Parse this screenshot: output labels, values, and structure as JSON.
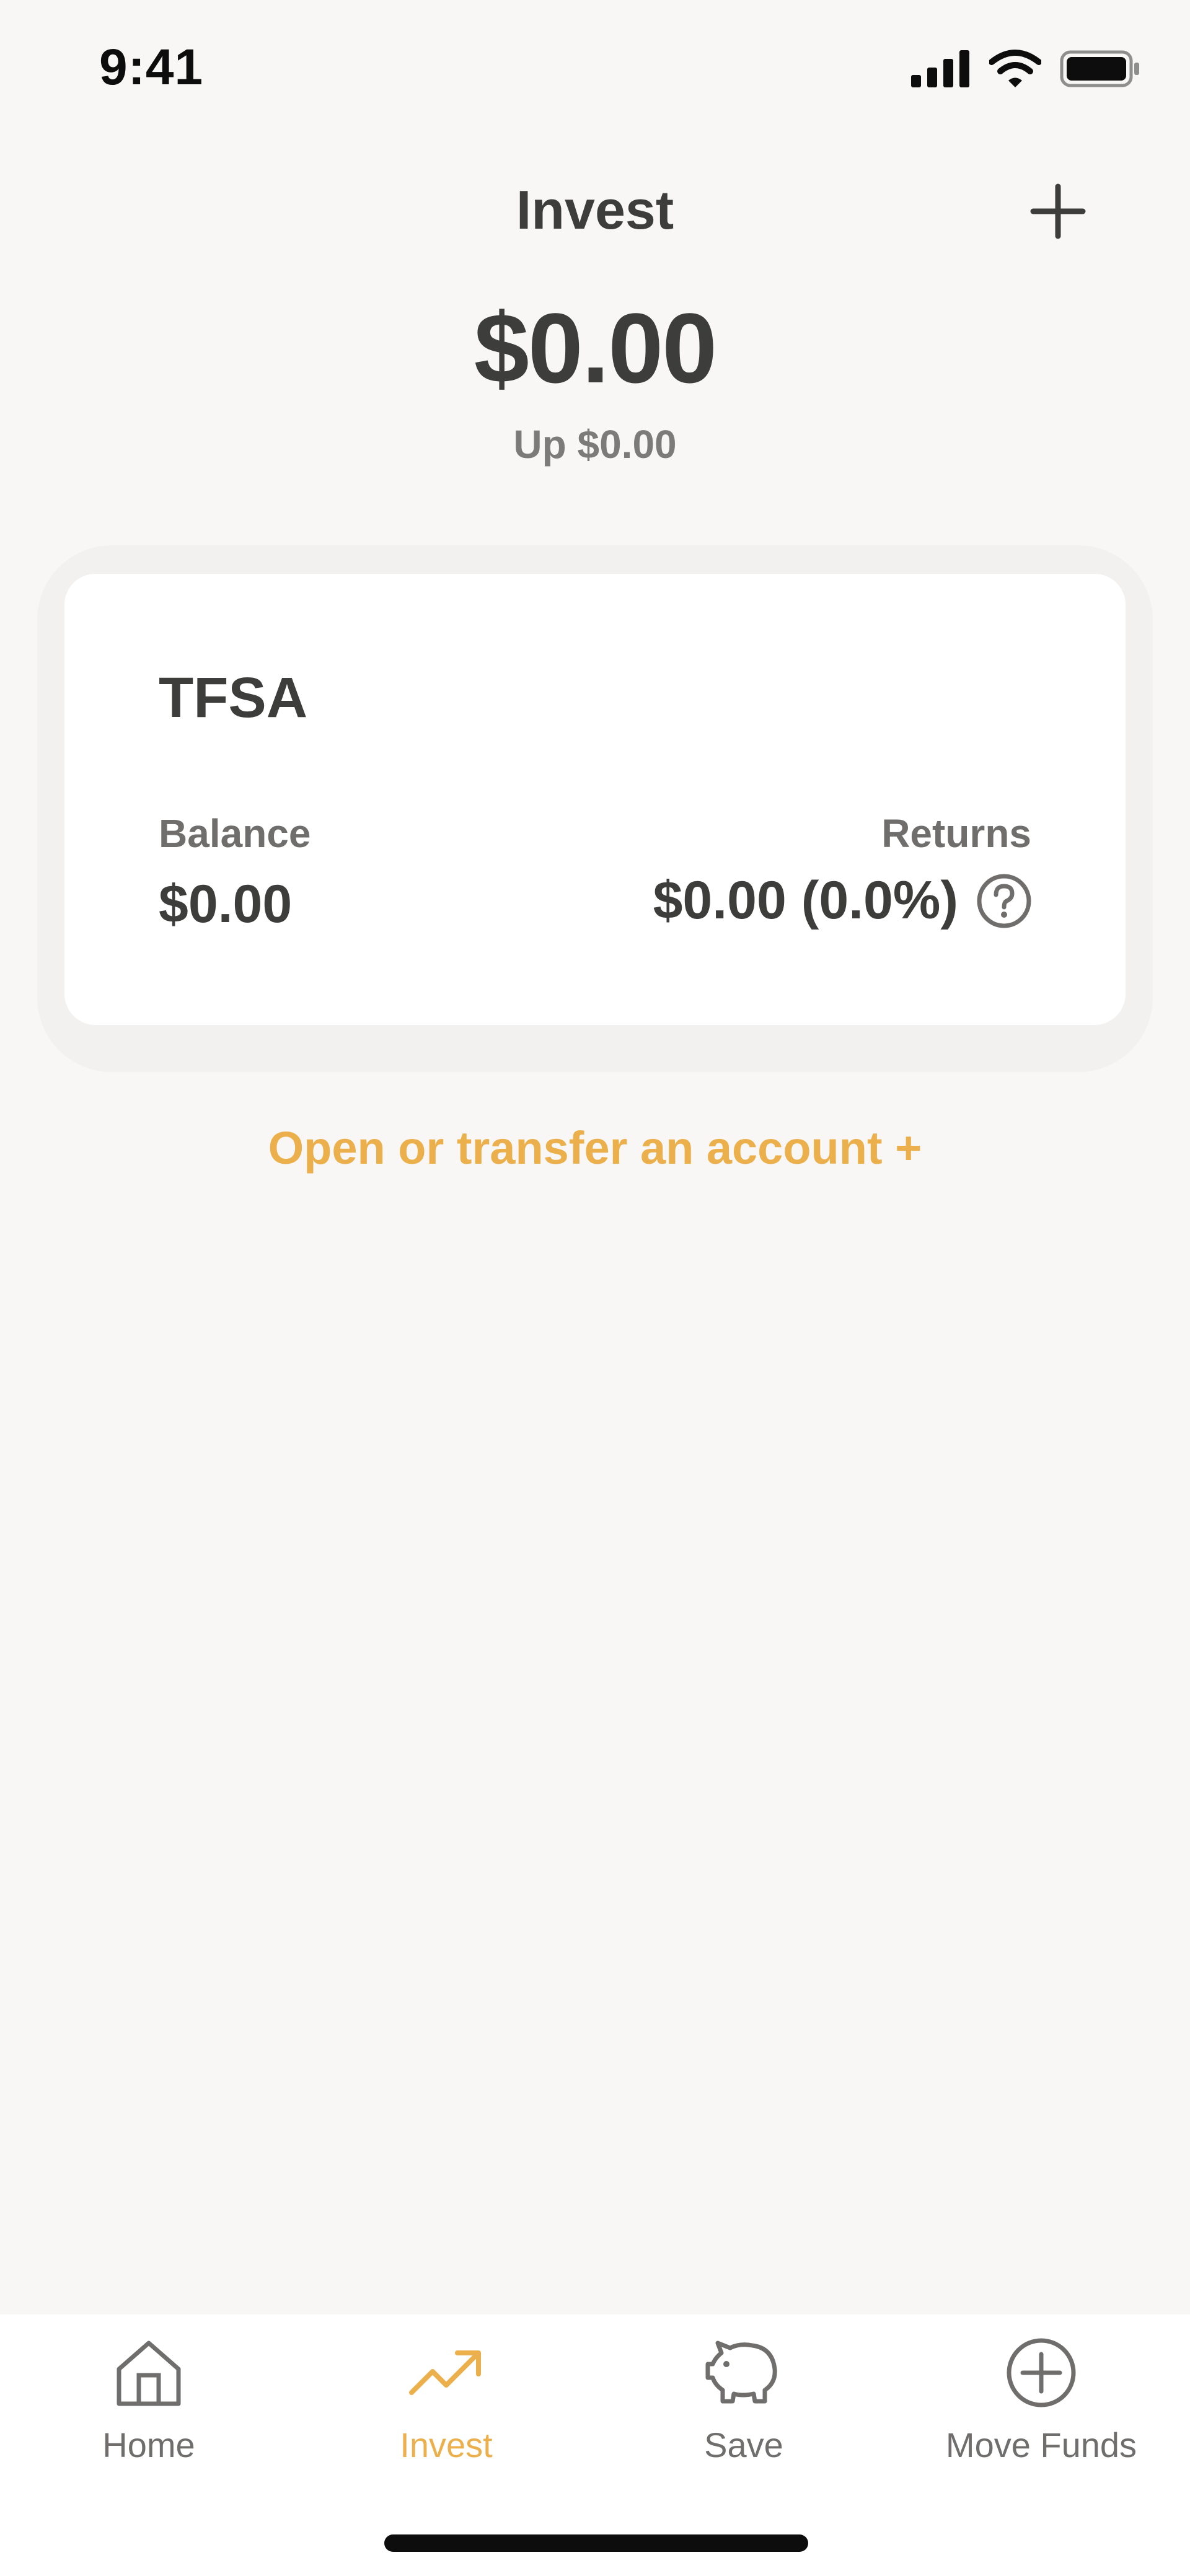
{
  "status_bar": {
    "time": "9:41"
  },
  "header": {
    "title": "Invest"
  },
  "summary": {
    "total": "$0.00",
    "change": "Up $0.00"
  },
  "account_card": {
    "name": "TFSA",
    "balance_label": "Balance",
    "balance_value": "$0.00",
    "returns_label": "Returns",
    "returns_value": "$0.00 (0.0%)"
  },
  "open_account_link": "Open or transfer an account +",
  "tab_bar": {
    "active": "Invest",
    "tabs": [
      {
        "label": "Home",
        "icon": "home-icon"
      },
      {
        "label": "Invest",
        "icon": "trending-up-icon"
      },
      {
        "label": "Save",
        "icon": "piggy-bank-icon"
      },
      {
        "label": "Move Funds",
        "icon": "plus-circle-icon"
      }
    ]
  },
  "colors": {
    "background": "#f8f7f6",
    "accent": "#ebb04c",
    "text_primary": "#3d3d3b",
    "text_secondary": "#6f6e6c",
    "card": "#ffffff"
  }
}
